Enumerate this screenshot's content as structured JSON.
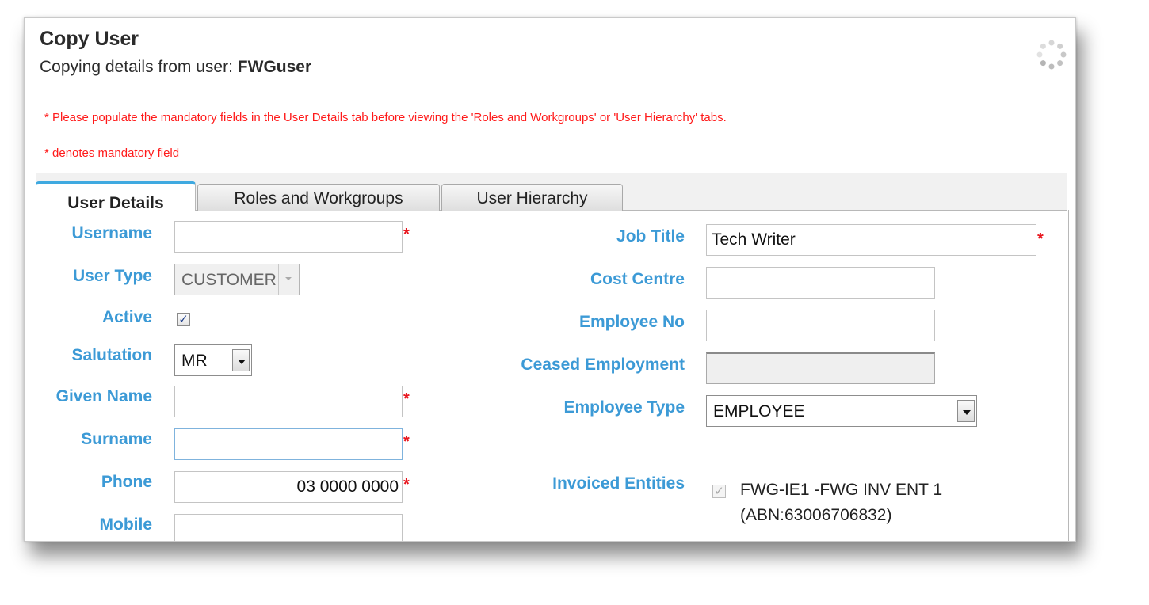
{
  "header": {
    "title": "Copy User",
    "subtitle_prefix": "Copying details from user:",
    "source_user": "FWGuser"
  },
  "notices": {
    "populate_warning": "* Please populate the mandatory fields in the User Details tab before viewing the 'Roles and Workgroups' or 'User Hierarchy' tabs.",
    "mandatory_note": "* denotes mandatory field"
  },
  "tabs": [
    {
      "label": "User Details",
      "active": true
    },
    {
      "label": "Roles and Workgroups",
      "active": false
    },
    {
      "label": "User Hierarchy",
      "active": false
    }
  ],
  "form_left": {
    "username": {
      "label": "Username",
      "value": "",
      "required": true
    },
    "user_type": {
      "label": "User Type",
      "value": "CUSTOMER"
    },
    "active": {
      "label": "Active",
      "checked": true
    },
    "salutation": {
      "label": "Salutation",
      "value": "MR"
    },
    "given_name": {
      "label": "Given Name",
      "value": "",
      "required": true
    },
    "surname": {
      "label": "Surname",
      "value": "",
      "required": true
    },
    "phone": {
      "label": "Phone",
      "value": "03 0000 0000",
      "required": true
    },
    "mobile": {
      "label": "Mobile",
      "value": ""
    }
  },
  "form_right": {
    "job_title": {
      "label": "Job Title",
      "value": "Tech Writer",
      "required": true
    },
    "cost_centre": {
      "label": "Cost Centre",
      "value": ""
    },
    "employee_no": {
      "label": "Employee No",
      "value": ""
    },
    "ceased_employment": {
      "label": "Ceased Employment",
      "value": ""
    },
    "employee_type": {
      "label": "Employee Type",
      "value": "EMPLOYEE"
    },
    "invoiced_entities": {
      "label": "Invoiced Entities",
      "items": [
        {
          "line1": "FWG-IE1 -FWG INV ENT 1",
          "line2": "(ABN:63006706832)",
          "checked": true
        }
      ]
    }
  },
  "symbols": {
    "required_mark": "*",
    "check_mark": "✓"
  },
  "colors": {
    "label_blue": "#3c9ad6",
    "required_red": "#e8141c",
    "warning_red": "#ff1a1a",
    "tab_accent": "#3fa9e0"
  },
  "icons": {
    "loading": "spinner-icon",
    "dropdown": "chevron-down-icon"
  }
}
